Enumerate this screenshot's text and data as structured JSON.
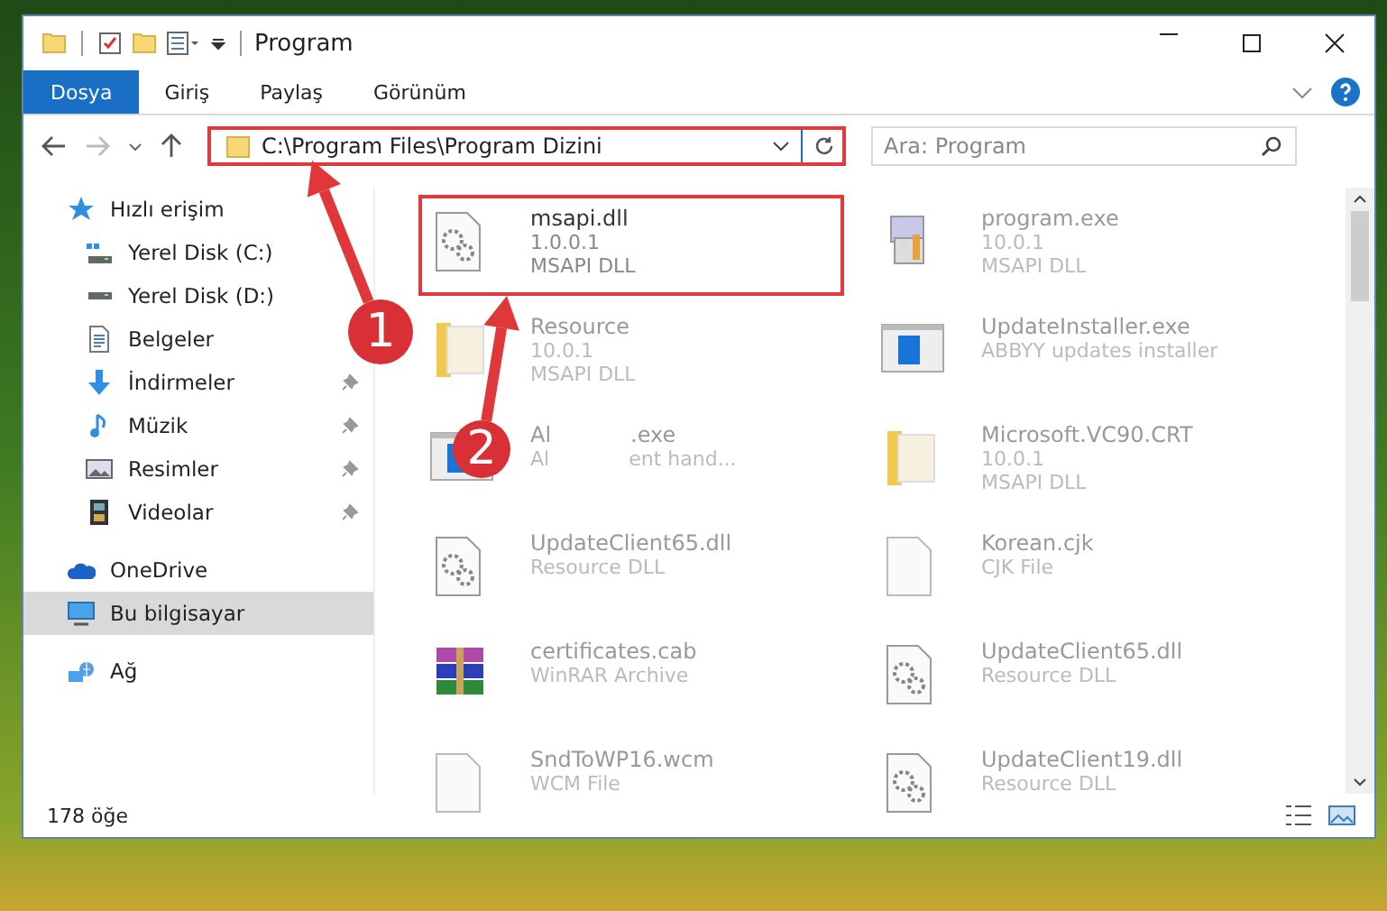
{
  "window": {
    "title": "Program"
  },
  "ribbon": {
    "tabs": [
      {
        "label": "Dosya",
        "selected": true
      },
      {
        "label": "Giriş",
        "selected": false
      },
      {
        "label": "Paylaş",
        "selected": false
      },
      {
        "label": "Görünüm",
        "selected": false
      }
    ]
  },
  "address_bar": {
    "value": "C:\\Program Files\\Program Dizini",
    "highlighted": true
  },
  "search": {
    "placeholder": "Ara: Program"
  },
  "sidebar": {
    "items": [
      {
        "label": "Hızlı erişim",
        "kind": "section",
        "pinned": false,
        "selected": false
      },
      {
        "label": "Yerel Disk (C:)",
        "kind": "entry",
        "pinned": false,
        "selected": false
      },
      {
        "label": "Yerel Disk (D:)",
        "kind": "entry",
        "pinned": false,
        "selected": false
      },
      {
        "label": "Belgeler",
        "kind": "entry",
        "pinned": false,
        "selected": false
      },
      {
        "label": "İndirmeler",
        "kind": "entry",
        "pinned": true,
        "selected": false
      },
      {
        "label": "Müzik",
        "kind": "entry",
        "pinned": true,
        "selected": false
      },
      {
        "label": "Resimler",
        "kind": "entry",
        "pinned": true,
        "selected": false
      },
      {
        "label": "Videolar",
        "kind": "entry",
        "pinned": true,
        "selected": false
      },
      {
        "label": "OneDrive",
        "kind": "section",
        "pinned": false,
        "selected": false
      },
      {
        "label": "Bu bilgisayar",
        "kind": "section",
        "pinned": false,
        "selected": true
      },
      {
        "label": "Ağ",
        "kind": "section",
        "pinned": false,
        "selected": false
      }
    ]
  },
  "files": [
    {
      "name": "msapi.dll",
      "details": [
        "1.0.0.1",
        "MSAPI DLL"
      ],
      "kind": "dll",
      "highlighted": true
    },
    {
      "name": "program.exe",
      "details": [
        "10.0.1",
        "MSAPI DLL"
      ],
      "kind": "program",
      "highlighted": false
    },
    {
      "name": "Resource",
      "details": [
        "10.0.1",
        "MSAPI DLL"
      ],
      "kind": "folder",
      "highlighted": false
    },
    {
      "name": "UpdateInstaller.exe",
      "details": [
        "ABBYY updates installer"
      ],
      "kind": "window",
      "highlighted": false
    },
    {
      "name_parts": [
        "Al",
        ".exe"
      ],
      "detail_parts": [
        "Al",
        "ent hand..."
      ],
      "kind": "window",
      "highlighted": false
    },
    {
      "name": "Microsoft.VC90.CRT",
      "details": [
        "10.0.1",
        "MSAPI DLL"
      ],
      "kind": "folder",
      "highlighted": false
    },
    {
      "name": "UpdateClient65.dll",
      "details": [
        "Resource DLL"
      ],
      "kind": "dll",
      "highlighted": false
    },
    {
      "name": "Korean.cjk",
      "details": [
        "CJK File"
      ],
      "kind": "blank",
      "highlighted": false
    },
    {
      "name": "certificates.cab",
      "details": [
        "WinRAR Archive"
      ],
      "kind": "archive",
      "highlighted": false
    },
    {
      "name": "UpdateClient65.dll",
      "details": [
        "Resource DLL"
      ],
      "kind": "dll",
      "highlighted": false
    },
    {
      "name": "SndToWP16.wcm",
      "details": [
        "WCM File"
      ],
      "kind": "blank",
      "highlighted": false
    },
    {
      "name": "UpdateClient19.dll",
      "details": [
        "Resource DLL"
      ],
      "kind": "dll",
      "highlighted": false
    }
  ],
  "status_bar": {
    "count": "178 öğe"
  },
  "annotations": [
    {
      "number": "1"
    },
    {
      "number": "2"
    }
  ]
}
